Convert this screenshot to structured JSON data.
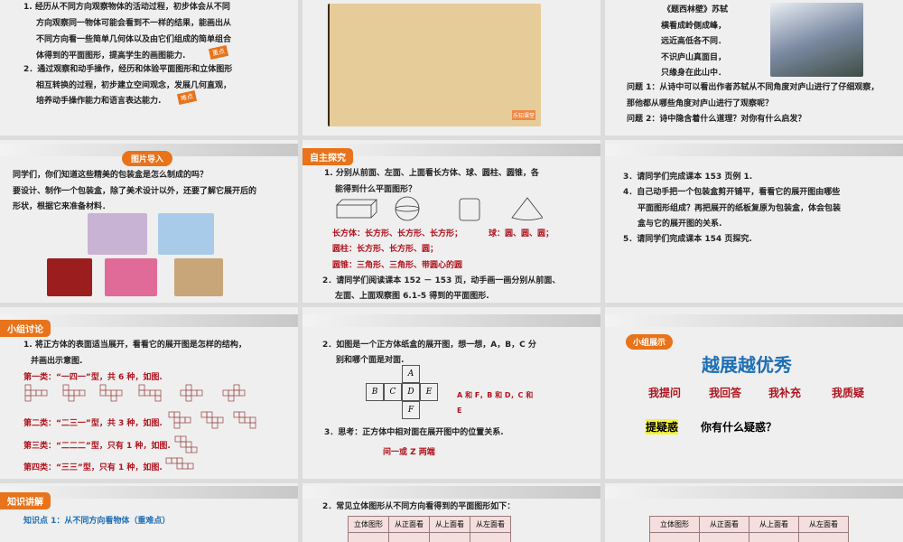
{
  "s1": {
    "l1": "1.   经历从不同方向观察物体的活动过程，初步体会从不同",
    "l2": "方向观察同一物体可能会看到不一样的结果，能画出从",
    "l3": "不同方向看一些简单几何体以及由它们组成的简单组合",
    "l4": "体得到的平面图形，提高学生的画图能力.",
    "tag1": "重点",
    "l5": "2．通过观察和动手操作，经历和体验平面图形和立体图形",
    "l6": "相互转换的过程，初步建立空间观念，发展几何直观，",
    "l7": "培养动手操作能力和语言表达能力.",
    "tag2": "难点"
  },
  "s2": {
    "logo": "乐知课堂"
  },
  "s3": {
    "title": "《题西林壁》苏轼",
    "p1": "横看成岭侧成峰，",
    "p2": "远近高低各不同．",
    "p3": "不识庐山真面目，",
    "p4": "只缘身在此山中．",
    "q1a": "问题 1：从诗中可以看出作者苏轼从不同角度对庐山进行了仔细观察，",
    "q1b": "那他都从哪些角度对庐山进行了观察呢？",
    "q2": "问题 2：诗中隐含着什么道理？对你有什么启发？"
  },
  "s4": {
    "badge": "图片导入",
    "l1": "同学们，你们知道这些精美的包装盒是怎么制成的吗？",
    "l2": "要设计、制作一个包装盒，除了美术设计以外，还要了解它展开后的",
    "l3": "形状，根据它来准备材料．"
  },
  "s5": {
    "tab": "自主探究",
    "l1": "1.   分别从前面、左面、上面看长方体、球、圆柱、圆锥，各",
    "l2": "能得到什么平面图形？",
    "a1": "长方体：长方形、长方形、长方形；",
    "a2": "球：圆、圆、圆；",
    "a3": "圆柱：长方形、长方形、圆；",
    "a4": "圆锥：三角形、三角形、带圆心的圆",
    "l3": "2．请同学们阅读课本 152 － 153 页，动手画一画分别从前面、",
    "l4": "左面、上面观察图 6.1-5 得到的平面图形."
  },
  "s6": {
    "l1": "3．请同学们完成课本 153 页例 1.",
    "l2": "4．自己动手把一个包装盒剪开铺平，看看它的展开图由哪些",
    "l3": "平面图形组成？再把展开的纸板复原为包装盒，体会包装",
    "l4": "盒与它的展开图的关系.",
    "l5": "5．请同学们完成课本 154 页探究."
  },
  "s7": {
    "tab": "小组讨论",
    "l1": "1.  将正方体的表面适当展开，看看它的展开图是怎样的结构，",
    "l2": "并画出示意图.",
    "c1": "第一类：“一四一”型，共 6 种，如图.",
    "c2": "第二类：“二三一”型，共 3 种，如图.",
    "c3": "第三类：“二二二”型，只有 1 种，如图.",
    "c4": "第四类：“三三”型，只有 1 种，如图."
  },
  "s8": {
    "l1": "2．如图是一个正方体纸盒的展开图，想一想，A，B，C 分",
    "l2": "别和哪个面是对面.",
    "faces": [
      "A",
      "B",
      "C",
      "D",
      "E",
      "F"
    ],
    "ans1": "A 和 F，B 和 D，C 和",
    "ans2": "E",
    "l3": "3．思考：正方体中相对面在展开图中的位置关系.",
    "ans3": "间一或 Z 两端"
  },
  "s9": {
    "badge": "小组展示",
    "title": "越展越优秀",
    "items": [
      "我提问",
      "我回答",
      "我补充",
      "我质疑"
    ],
    "hl": "提疑惑",
    "q": "你有什么疑惑？"
  },
  "s10": {
    "tab": "知识讲解",
    "k": "知识点 1：从不同方向看物体（重难点）"
  },
  "s11": {
    "l1": "2．常见立体图形从不同方向看得到的平面图形如下：",
    "headers": [
      "立体图形",
      "从正面看",
      "从上面看",
      "从左面看"
    ]
  },
  "s12": {
    "headers": [
      "立体图形",
      "从正面看",
      "从上面看",
      "从左面看"
    ]
  }
}
